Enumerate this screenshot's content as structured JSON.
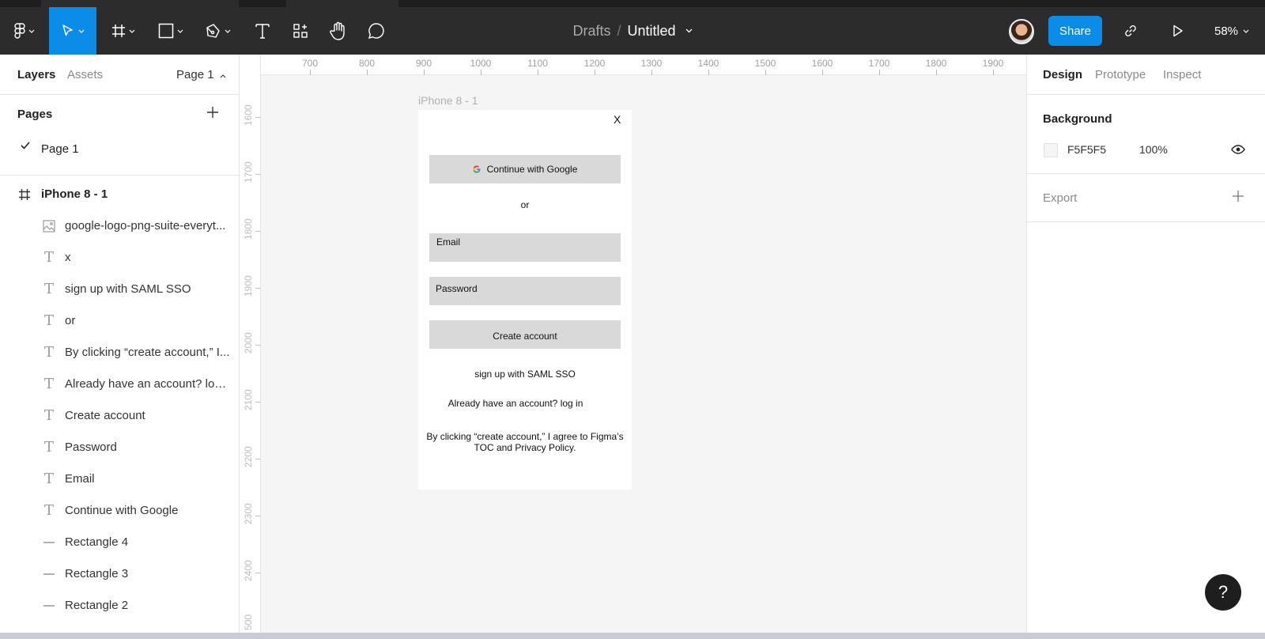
{
  "toolbar": {
    "breadcrumb_parent": "Drafts",
    "breadcrumb_sep": "/",
    "file_name": "Untitled",
    "share_label": "Share",
    "zoom_level": "58%",
    "active_tool": "move",
    "accent_color": "#0C8CE9"
  },
  "left_panel": {
    "tabs": {
      "layers": "Layers",
      "assets": "Assets",
      "page_selector": "Page 1"
    },
    "pages_heading": "Pages",
    "pages": [
      {
        "label": "Page 1",
        "selected": true
      }
    ],
    "frame": {
      "label": "iPhone 8 - 1",
      "icon": "frame-icon"
    },
    "layers": [
      {
        "label": "google-logo-png-suite-everyt...",
        "icon": "image-icon"
      },
      {
        "label": "x",
        "icon": "text-icon"
      },
      {
        "label": "sign up with SAML SSO",
        "icon": "text-icon"
      },
      {
        "label": "or",
        "icon": "text-icon"
      },
      {
        "label": "By clicking “create account,” I...",
        "icon": "text-icon"
      },
      {
        "label": "Already have an account? log in",
        "icon": "text-icon"
      },
      {
        "label": "Create account",
        "icon": "text-icon"
      },
      {
        "label": "Password",
        "icon": "text-icon"
      },
      {
        "label": "Email",
        "icon": "text-icon"
      },
      {
        "label": "Continue with Google",
        "icon": "text-icon"
      },
      {
        "label": "Rectangle 4",
        "icon": "rectangle-icon"
      },
      {
        "label": "Rectangle 3",
        "icon": "rectangle-icon"
      },
      {
        "label": "Rectangle 2",
        "icon": "rectangle-icon"
      }
    ]
  },
  "canvas": {
    "ruler_top": [
      "700",
      "800",
      "900",
      "1000",
      "1100",
      "1200",
      "1300",
      "1400",
      "1500",
      "1600",
      "1700",
      "1800",
      "1900"
    ],
    "ruler_left": [
      "1600",
      "1700",
      "1800",
      "1900",
      "2000",
      "2100",
      "2200",
      "2300",
      "2400",
      "500"
    ],
    "frame_label": "iPhone 8 - 1",
    "phone": {
      "close": "X",
      "google_button": "Continue with Google",
      "or": "or",
      "email_label": "Email",
      "password_label": "Password",
      "create_button": "Create account",
      "saml": "sign up with  SAML SSO",
      "login": "Already have an account? log in",
      "terms_line1": "By clicking “create account,” I agree to Figma’s",
      "terms_line2": "TOC and Privacy Policy."
    }
  },
  "right_panel": {
    "tabs": {
      "design": "Design",
      "prototype": "Prototype",
      "inspect": "Inspect"
    },
    "background": {
      "heading": "Background",
      "hex": "F5F5F5",
      "opacity": "100%",
      "swatch_color": "#F5F5F5"
    },
    "export": {
      "heading": "Export"
    }
  },
  "help": {
    "label": "?"
  }
}
